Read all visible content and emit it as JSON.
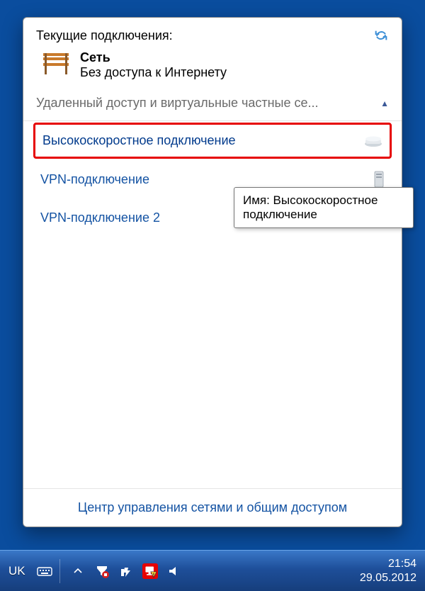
{
  "popup": {
    "title": "Текущие подключения:",
    "network": {
      "name": "Сеть",
      "status": "Без доступа к Интернету"
    },
    "section_title": "Удаленный доступ и виртуальные частные се...",
    "connections": [
      {
        "label": "Высокоскоростное подключение",
        "highlighted": true,
        "icon": "modem"
      },
      {
        "label": "VPN-подключение",
        "highlighted": false,
        "icon": "server"
      },
      {
        "label": "VPN-подключение 2",
        "highlighted": false,
        "icon": "server"
      }
    ],
    "footer_link": "Центр управления сетями и общим доступом"
  },
  "tooltip": {
    "line1": "Имя: Высокоскоростное",
    "line2": "подключение"
  },
  "taskbar": {
    "language": "UK",
    "clock_time": "21:54",
    "clock_date": "29.05.2012"
  }
}
